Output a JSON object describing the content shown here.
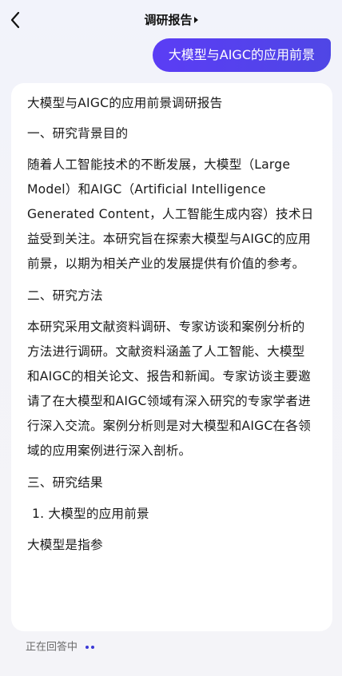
{
  "header": {
    "title": "调研报告"
  },
  "user_message": "大模型与AIGC的应用前景",
  "answer": {
    "title": "大模型与AIGC的应用前景调研报告",
    "section1_heading": "一、研究背景目的",
    "section1_text": "随着人工智能技术的不断发展，大模型（Large Model）和AIGC（Artificial Intelligence Generated Content，人工智能生成内容）技术日益受到关注。本研究旨在探索大模型与AIGC的应用前景，以期为相关产业的发展提供有价值的参考。",
    "section2_heading": "二、研究方法",
    "section2_text": "本研究采用文献资料调研、专家访谈和案例分析的方法进行调研。文献资料涵盖了人工智能、大模型和AIGC的相关论文、报告和新闻。专家访谈主要邀请了在大模型和AIGC领域有深入研究的专家学者进行深入交流。案例分析则是对大模型和AIGC在各领域的应用案例进行深入剖析。",
    "section3_heading": "三、研究结果",
    "list_item_1": "1. 大模型的应用前景",
    "partial_text": "大模型是指参"
  },
  "status": {
    "text": "正在回答中"
  },
  "colors": {
    "accent": "#4f46e5",
    "bubble_text": "#ffffff",
    "status_dot": "#3b39d6"
  },
  "icons": {
    "back": "chevron-left-icon",
    "title_dropdown": "caret-right-icon",
    "typing": "typing-dots-icon"
  }
}
